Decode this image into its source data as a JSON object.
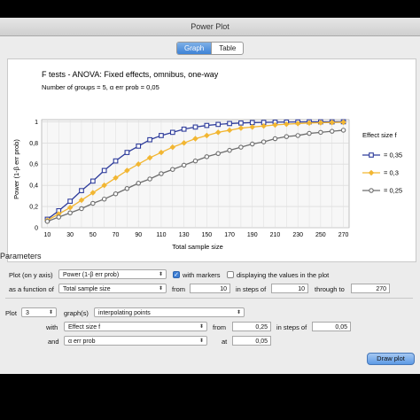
{
  "window": {
    "title": "Power Plot"
  },
  "tabs": [
    {
      "label": "Graph",
      "active": true
    },
    {
      "label": "Table",
      "active": false
    }
  ],
  "plot": {
    "title": "F tests - ANOVA: Fixed effects, omnibus, one-way",
    "subtitle": "Number of groups = 5, α err prob = 0,05"
  },
  "chart_data": {
    "type": "line",
    "title": "F tests - ANOVA: Fixed effects, omnibus, one-way",
    "subtitle": "Number of groups = 5, α err prob = 0,05",
    "xlabel": "Total sample size",
    "ylabel": "Power (1-β err prob)",
    "x": [
      10,
      20,
      30,
      40,
      50,
      60,
      70,
      80,
      90,
      100,
      110,
      120,
      130,
      140,
      150,
      160,
      170,
      180,
      190,
      200,
      210,
      220,
      230,
      240,
      250,
      260,
      270
    ],
    "xticks": [
      "10",
      "30",
      "50",
      "70",
      "90",
      "110",
      "130",
      "150",
      "170",
      "190",
      "210",
      "230",
      "250",
      "270"
    ],
    "xtick_values": [
      10,
      30,
      50,
      70,
      90,
      110,
      130,
      150,
      170,
      190,
      210,
      230,
      250,
      270
    ],
    "yticks": [
      "0",
      "0,2",
      "0,4",
      "0,6",
      "0,8",
      "1"
    ],
    "ytick_values": [
      0,
      0.2,
      0.4,
      0.6,
      0.8,
      1
    ],
    "xlim": [
      5,
      275
    ],
    "ylim": [
      0,
      1.02
    ],
    "grid": true,
    "legend": {
      "title": "Effect size f",
      "position": "right"
    },
    "series": [
      {
        "name": "= 0,35",
        "color": "#2e3c9b",
        "marker": "square",
        "values": [
          0.08,
          0.16,
          0.25,
          0.35,
          0.44,
          0.54,
          0.63,
          0.71,
          0.77,
          0.83,
          0.87,
          0.9,
          0.93,
          0.95,
          0.965,
          0.975,
          0.983,
          0.988,
          0.992,
          0.994,
          0.996,
          0.997,
          0.998,
          0.999,
          0.999,
          0.999,
          1.0
        ]
      },
      {
        "name": "= 0,3",
        "color": "#f2b632",
        "marker": "diamond",
        "values": [
          0.07,
          0.13,
          0.19,
          0.26,
          0.33,
          0.4,
          0.47,
          0.54,
          0.6,
          0.66,
          0.71,
          0.76,
          0.8,
          0.84,
          0.87,
          0.9,
          0.92,
          0.94,
          0.95,
          0.96,
          0.97,
          0.977,
          0.983,
          0.988,
          0.991,
          0.993,
          0.995
        ]
      },
      {
        "name": "= 0,25",
        "color": "#6e6e6e",
        "marker": "circle",
        "values": [
          0.06,
          0.1,
          0.14,
          0.18,
          0.23,
          0.27,
          0.32,
          0.37,
          0.42,
          0.46,
          0.51,
          0.55,
          0.59,
          0.63,
          0.67,
          0.7,
          0.73,
          0.76,
          0.79,
          0.81,
          0.84,
          0.86,
          0.87,
          0.89,
          0.9,
          0.91,
          0.92
        ]
      }
    ]
  },
  "parameters": {
    "section_label": "Parameters",
    "plot_on_y_label": "Plot (on y axis)",
    "plot_on_y_value": "Power (1-β err prob)",
    "with_markers_label": "with markers",
    "with_markers_checked": true,
    "display_values_label": "displaying the values in the plot",
    "display_values_checked": false,
    "as_function_label": "as a function of",
    "as_function_value": "Total sample size",
    "from_label": "from",
    "from_value": "10",
    "steps_label": "in steps of",
    "steps_value": "10",
    "through_label": "through to",
    "through_value": "270",
    "plot_label": "Plot",
    "plot_count": "3",
    "graphs_label": "graph(s)",
    "interp_value": "interpolating points",
    "with_label": "with",
    "with_value": "Effect size f",
    "with_from_label": "from",
    "with_from_value": "0,25",
    "with_steps_label": "in steps of",
    "with_steps_value": "0,05",
    "and_label": "and",
    "and_value": "α err prob",
    "at_label": "at",
    "at_value": "0,05",
    "draw_button": "Draw plot"
  }
}
